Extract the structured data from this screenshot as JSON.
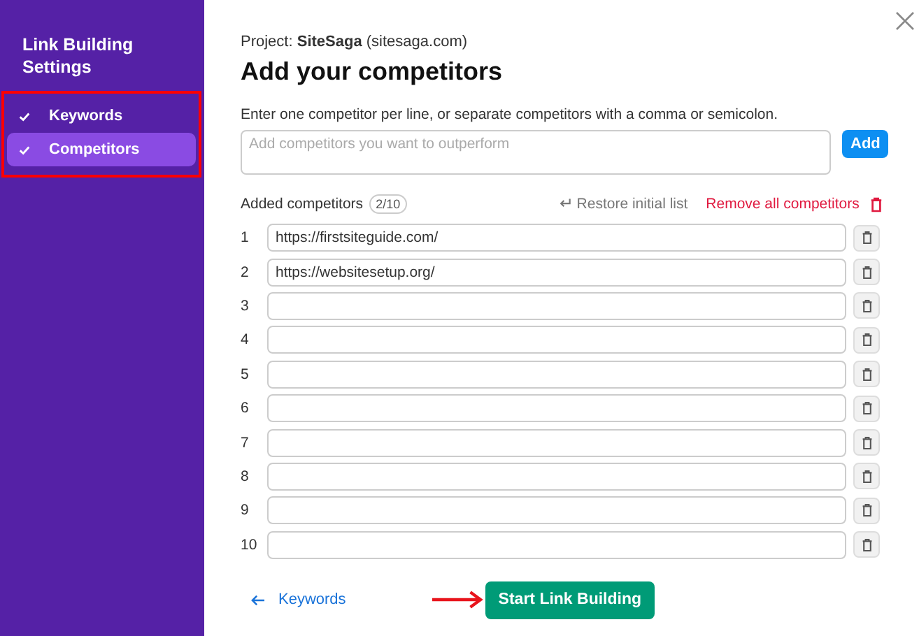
{
  "sidebar": {
    "title": "Link Building Settings",
    "items": [
      {
        "label": "Keywords",
        "checked": true,
        "selected": false
      },
      {
        "label": "Competitors",
        "checked": true,
        "selected": true
      }
    ]
  },
  "project": {
    "label": "Project:",
    "name": "SiteSaga",
    "domain": "(sitesaga.com)"
  },
  "heading": "Add your competitors",
  "instructions": "Enter one competitor per line, or separate competitors with a comma or semicolon.",
  "competitor_input": {
    "placeholder": "Add competitors you want to outperform"
  },
  "add_button": "Add",
  "list_header": {
    "label": "Added competitors",
    "count": "2/10",
    "restore": "Restore initial list",
    "remove_all": "Remove all competitors"
  },
  "rows": [
    {
      "number": "1",
      "value": "https://firstsiteguide.com/"
    },
    {
      "number": "2",
      "value": "https://websitesetup.org/"
    },
    {
      "number": "3"
    },
    {
      "number": "4"
    },
    {
      "number": "5"
    },
    {
      "number": "6"
    },
    {
      "number": "7"
    },
    {
      "number": "8"
    },
    {
      "number": "9"
    },
    {
      "number": "10"
    }
  ],
  "back_link": "Keywords",
  "start_button": "Start Link Building"
}
